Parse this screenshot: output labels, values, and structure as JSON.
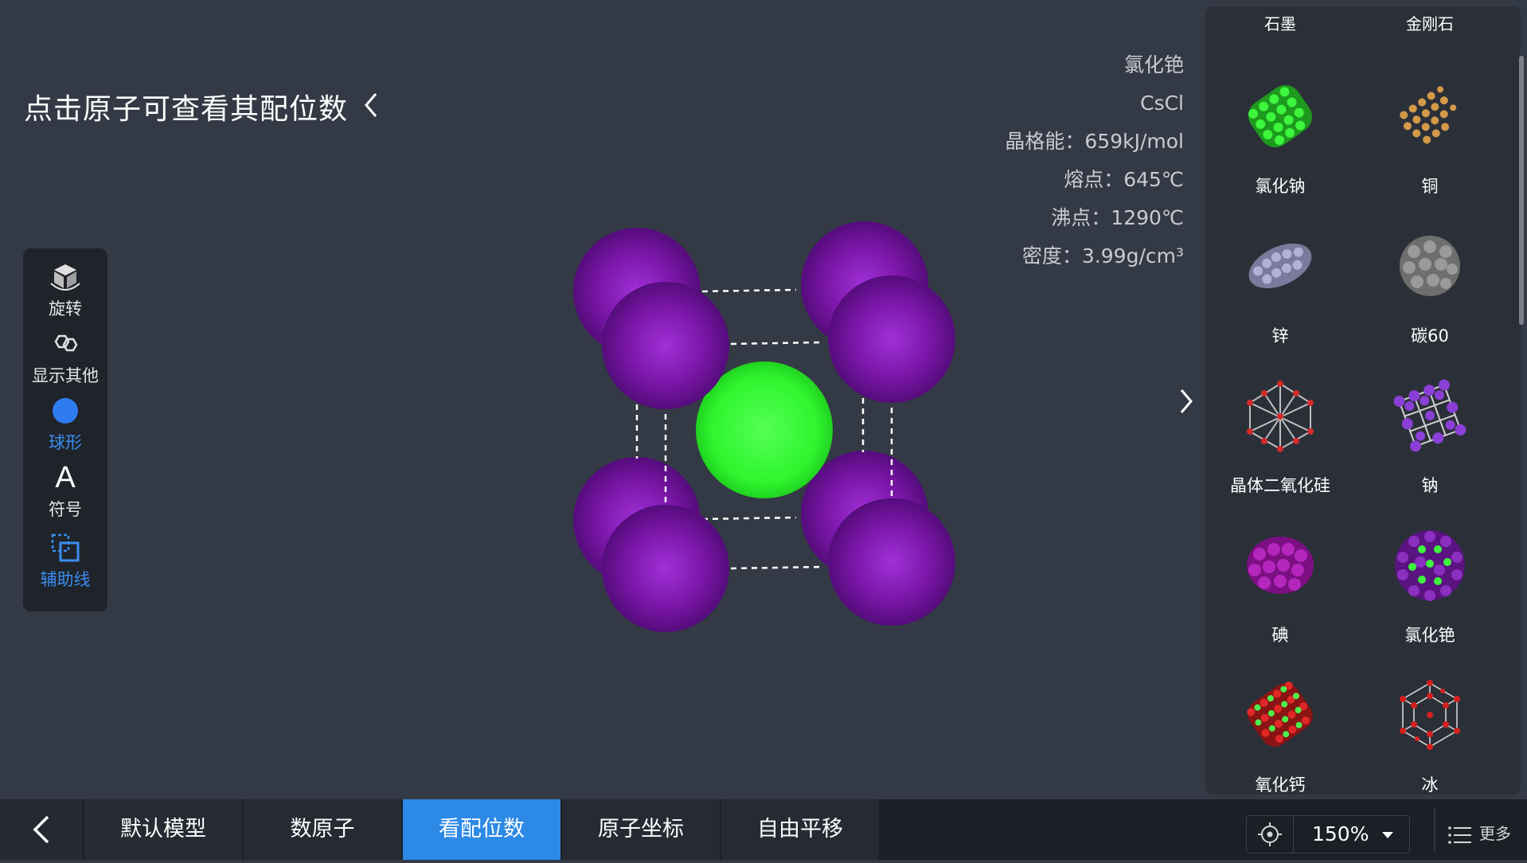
{
  "hint": {
    "text": "点击原子可查看其配位数"
  },
  "toolbar": {
    "rotate": "旋转",
    "show_other": "显示其他",
    "sphere": "球形",
    "symbol": "符号",
    "symbol_glyph": "A",
    "guide": "辅助线"
  },
  "info": {
    "name": "氯化铯",
    "formula": "CsCl",
    "lattice_energy": "晶格能：659kJ/mol",
    "melting_point": "熔点：645℃",
    "boiling_point": "沸点：1290℃",
    "density": "密度：3.99g/cm³"
  },
  "colors": {
    "cesium": "#7a16a8",
    "chlorine": "#2ef52e",
    "accent": "#2d89e6"
  },
  "side": {
    "header_left": "石墨",
    "header_right": "金刚石",
    "items": [
      {
        "label": "氯化钠"
      },
      {
        "label": "铜"
      },
      {
        "label": "锌"
      },
      {
        "label": "碳60"
      },
      {
        "label": "晶体二氧化硅"
      },
      {
        "label": "钠"
      },
      {
        "label": "碘"
      },
      {
        "label": "氯化铯"
      },
      {
        "label": "氧化钙"
      },
      {
        "label": "冰"
      }
    ]
  },
  "bottom": {
    "tabs": [
      {
        "label": "默认模型"
      },
      {
        "label": "数原子"
      },
      {
        "label": "看配位数"
      },
      {
        "label": "原子坐标"
      },
      {
        "label": "自由平移"
      }
    ],
    "zoom": "150%",
    "more": "更多"
  }
}
